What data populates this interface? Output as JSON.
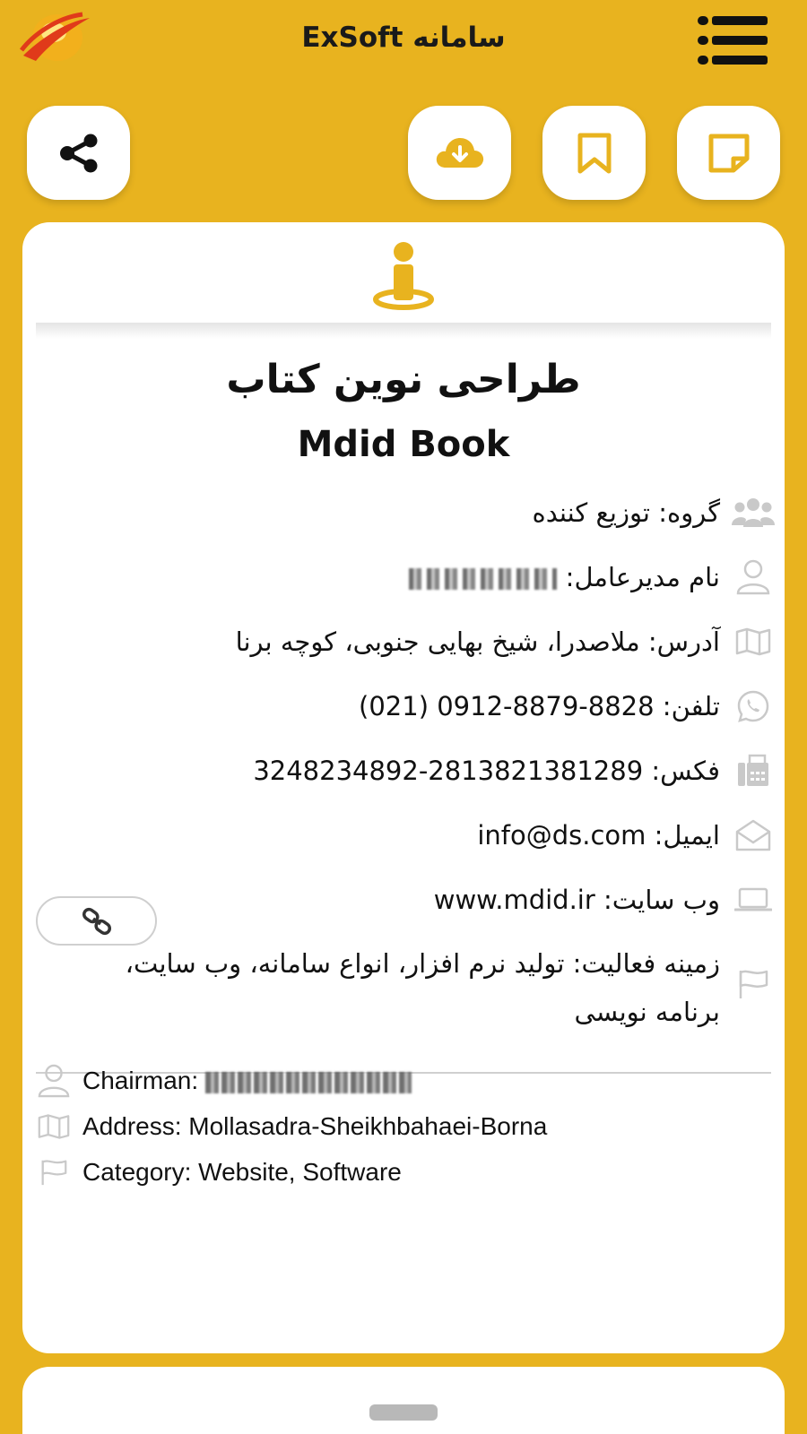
{
  "app": {
    "title": "سامانه ExSoft"
  },
  "actions": {
    "share": "share-icon",
    "download": "cloud-download-icon",
    "bookmark": "bookmark-icon",
    "note": "note-icon"
  },
  "company": {
    "name_fa": "طراحی نوین کتاب",
    "name_en": "Mdid Book"
  },
  "info_fa": {
    "group": "گروه: توزیع کننده",
    "manager_label": "نام مدیرعامل:",
    "address": "آدرس: ملاصدرا، شیخ بهایی جنوبی، کوچه برنا",
    "phone_label": "تلفن:",
    "phone_value": "(021) 0912-8879-8828",
    "fax_label": "فکس:",
    "fax_value": "3248234892-2813821381289",
    "email_label": "ایمیل:",
    "email_value": "info@ds.com",
    "website_label": "وب سایت:",
    "website_value": "www.mdid.ir",
    "activity": "زمینه فعالیت: تولید نرم افزار، انواع سامانه، وب سایت، برنامه نویسی"
  },
  "info_en": {
    "chairman_label": "Chairman:",
    "address": "Address: Mollasadra-Sheikhbahaei-Borna",
    "category": "Category: Website, Software"
  },
  "colors": {
    "accent": "#e8b31f",
    "card": "#ffffff",
    "icon_gray": "#c9c9c9"
  }
}
